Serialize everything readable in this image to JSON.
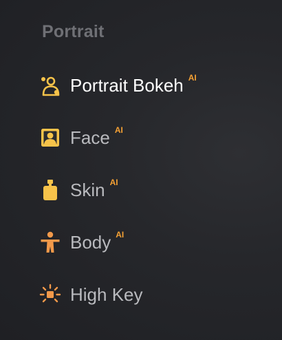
{
  "section": {
    "title": "Portrait"
  },
  "items": [
    {
      "label": "Portrait Bokeh",
      "badge": "AI",
      "icon": "portrait-bokeh-icon",
      "active": true
    },
    {
      "label": "Face",
      "badge": "AI",
      "icon": "face-portrait-icon",
      "active": false
    },
    {
      "label": "Skin",
      "badge": "AI",
      "icon": "skin-bottle-icon",
      "active": false
    },
    {
      "label": "Body",
      "badge": "AI",
      "icon": "body-figure-icon",
      "active": false
    },
    {
      "label": "High Key",
      "badge": "",
      "icon": "high-key-light-icon",
      "active": false
    }
  ],
  "colors": {
    "icon_yellow": "#f7c34a",
    "icon_orange": "#f2994a",
    "badge": "#f5a134",
    "active_text": "#ffffff",
    "inactive_text": "#b9babe",
    "section_title": "#6f7075"
  }
}
